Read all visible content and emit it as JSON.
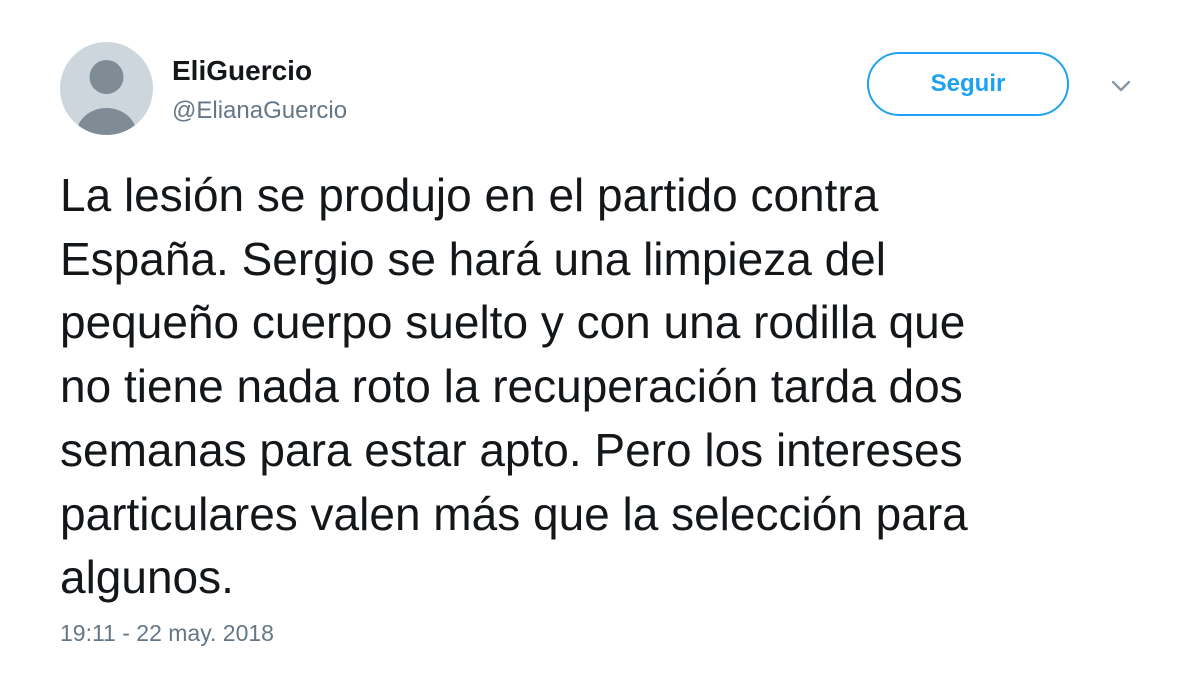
{
  "author": {
    "display_name": "EliGuercio",
    "handle": "@ElianaGuercio",
    "avatar_icon": "default-profile-icon"
  },
  "follow_button": {
    "label": "Seguir"
  },
  "menu": {
    "icon": "chevron-down-icon"
  },
  "tweet": {
    "text_lines": [
      "La lesión se produjo en el partido contra",
      "España. Sergio se hará una limpieza del",
      "pequeño cuerpo suelto y con una rodilla que",
      "no tiene nada roto la recuperación tarda dos",
      "semanas para estar apto. Pero los intereses",
      "particulares valen más que la selección para",
      "algunos."
    ],
    "timestamp": "19:11 - 22 may. 2018"
  },
  "colors": {
    "accent": "#1da1f2",
    "text": "#14171a",
    "secondary_text": "#657786",
    "avatar_bg": "#cdd6dd",
    "avatar_figure": "#7f8b95"
  }
}
